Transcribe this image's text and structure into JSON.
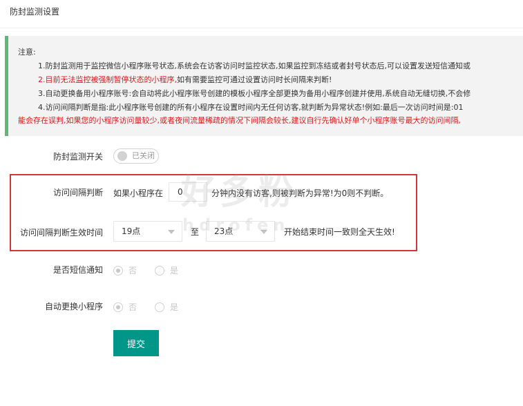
{
  "page": {
    "title": "防封监测设置"
  },
  "notice": {
    "title": "注意:",
    "line1": "1.防封监测用于监控微信小程序账号状态,系统会在访客访问时监控状态,如果监控到冻结或者封号状态后,可以设置发送短信通知或",
    "line2_red": "2.目前无法监控被强制暂停状态的小程序,",
    "line2_rest": "如有需要监控可通过设置访问时长间隔来判断!",
    "line3": "3.自动更换备用小程序账号:会自动将此小程序账号创建的模板小程序全部更换为备用小程序创建并使用,系统自动无缝切换,不会修",
    "line4": "4.访问间隔判断是指:此小程序账号创建的所有小程序在设置时间内无任何访客,就判断为异常状态!例如:最后一次访问时间是:01",
    "line5_red": "能会存在误判,如果您的小程序访问量较少,或者夜间流量稀疏的情况下间隔会较长,建议自行先确认好单个小程序账号最大的访问间隔,"
  },
  "form": {
    "switch": {
      "label": "防封监测开关",
      "state_text": "已关闭"
    },
    "interval": {
      "label": "访问间隔判断",
      "prefix": "如果小程序在",
      "value": "0",
      "suffix": "分钟内没有访客,则被判断为异常!为0则不判断。"
    },
    "effective_time": {
      "label": "访问间隔判断生效时间",
      "start": "19点",
      "separator": "至",
      "end": "23点",
      "hint": "开始结束时间一致则全天生效!"
    },
    "sms_notify": {
      "label": "是否短信通知",
      "option_no": "否",
      "option_yes": "是",
      "selected": "否"
    },
    "auto_switch": {
      "label": "自动更换小程序",
      "option_no": "否",
      "option_yes": "是",
      "selected": "否"
    },
    "submit_label": "提交"
  },
  "watermark": {
    "text": "好多粉",
    "subtext": "hdrofen"
  },
  "colors": {
    "accent": "#009688",
    "notice_border": "#5fb878",
    "warning_red": "#e0181a",
    "highlight_box": "#d4353a"
  }
}
